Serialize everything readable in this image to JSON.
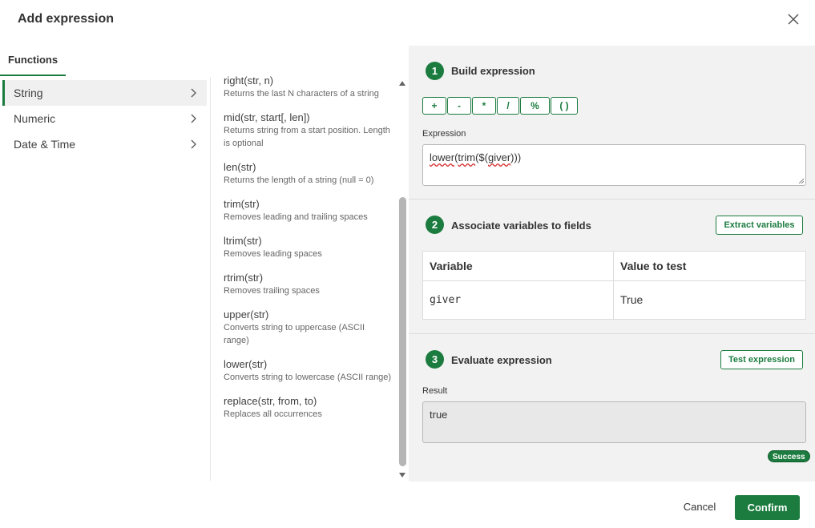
{
  "dialog": {
    "title": "Add expression",
    "cancel_label": "Cancel",
    "confirm_label": "Confirm"
  },
  "left": {
    "tab_label": "Functions",
    "categories": [
      {
        "label": "String",
        "active": true
      },
      {
        "label": "Numeric",
        "active": false
      },
      {
        "label": "Date & Time",
        "active": false
      }
    ]
  },
  "functions": [
    {
      "name": "right(str, n)",
      "desc": "Returns the last N characters of a string"
    },
    {
      "name": "mid(str, start[, len])",
      "desc": "Returns string from a start position. Length is optional"
    },
    {
      "name": "len(str)",
      "desc": "Returns the length of a string (null = 0)"
    },
    {
      "name": "trim(str)",
      "desc": "Removes leading and trailing spaces"
    },
    {
      "name": "ltrim(str)",
      "desc": "Removes leading spaces"
    },
    {
      "name": "rtrim(str)",
      "desc": "Removes trailing spaces"
    },
    {
      "name": "upper(str)",
      "desc": "Converts string to uppercase (ASCII range)"
    },
    {
      "name": "lower(str)",
      "desc": "Converts string to lowercase (ASCII range)"
    },
    {
      "name": "replace(str, from, to)",
      "desc": "Replaces all occurrences"
    }
  ],
  "build": {
    "step": "1",
    "title": "Build expression",
    "operators": [
      "+",
      "-",
      "*",
      "/",
      "%",
      "( )"
    ],
    "expression_label": "Expression",
    "expression_parts": [
      "lower",
      "(",
      "trim",
      "($(",
      "giver",
      ")))"
    ]
  },
  "associate": {
    "step": "2",
    "title": "Associate variables to fields",
    "extract_label": "Extract variables",
    "col_variable": "Variable",
    "col_value": "Value to test",
    "rows": [
      {
        "variable": "giver",
        "value": "True"
      }
    ]
  },
  "evaluate": {
    "step": "3",
    "title": "Evaluate expression",
    "test_label": "Test expression",
    "result_label": "Result",
    "result_value": "true",
    "status": "Success"
  },
  "colors": {
    "accent": "#1c7c3f",
    "panel_bg": "#f2f2f2",
    "spellcheck": "#d62b2b"
  }
}
